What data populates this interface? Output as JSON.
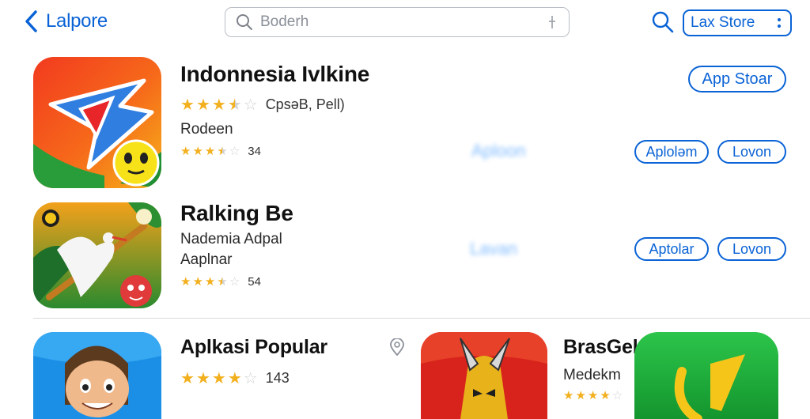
{
  "header": {
    "back_label": "Lalpore",
    "search_placeholder": "Boderh",
    "store_button": "Lax Store"
  },
  "apps": [
    {
      "title": "Indonnesia Ivlkine",
      "rating_text": "CpsəB, Pell)",
      "subtitle": "Rodeen",
      "rating_count": "34",
      "stars": 3.5,
      "button_top": "App Stoar",
      "button_primary": "Aploləm",
      "button_secondary": "Lovon",
      "ghost_label": "Aploon"
    },
    {
      "title": "Ralking Be",
      "subtitle": "Nademia Adpal",
      "subtitle2": "Aaplnar",
      "rating_count": "54",
      "stars": 3.5,
      "button_primary": "Aptolar",
      "button_secondary": "Lovon",
      "ghost_label": "Lavan"
    },
    {
      "title": "Aplkasi Popular",
      "rating_count": "143",
      "stars": 4
    },
    {
      "title": "BrasGek",
      "subtitle": "Medekm",
      "stars": 4
    }
  ],
  "colors": {
    "accent": "#0a63d6",
    "star": "#f2b01e"
  }
}
